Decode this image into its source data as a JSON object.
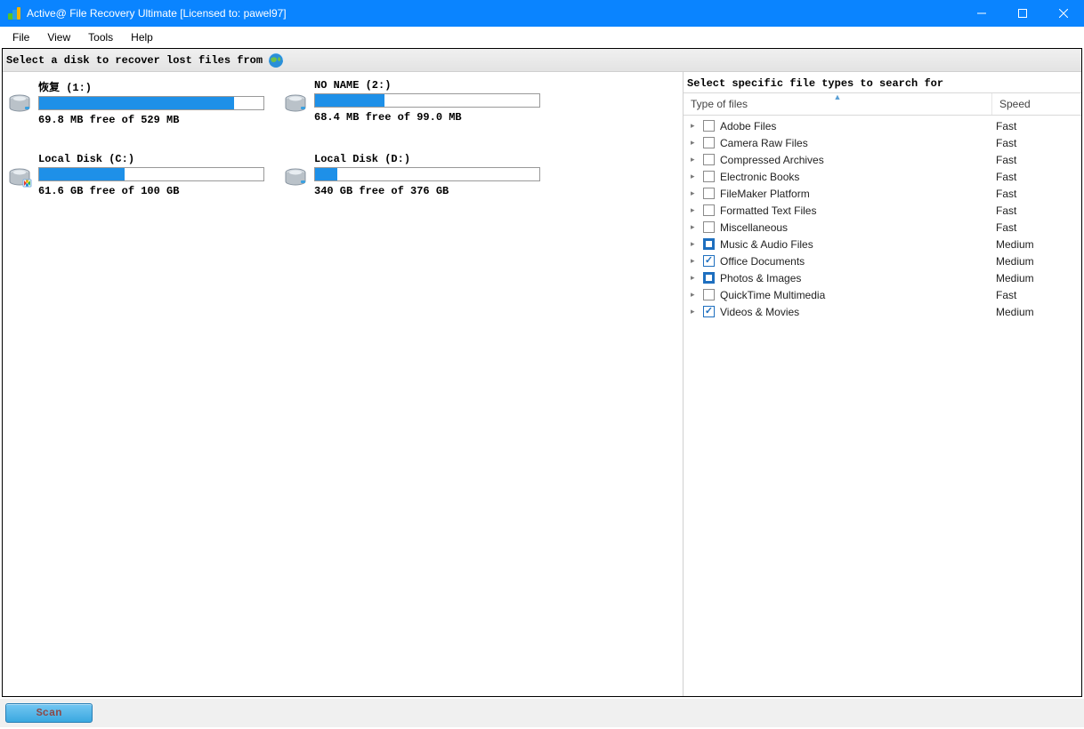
{
  "window": {
    "title": "Active@ File Recovery Ultimate [Licensed to: pawel97]"
  },
  "menu": {
    "file": "File",
    "view": "View",
    "tools": "Tools",
    "help": "Help"
  },
  "headline": "Select a disk to recover lost files from",
  "disks": [
    {
      "name": "恢复 (1:)",
      "free_text": "69.8 MB free of 529 MB",
      "used_pct": 87
    },
    {
      "name": "NO NAME (2:)",
      "free_text": "68.4 MB free of 99.0 MB",
      "used_pct": 31
    },
    {
      "name": "Local Disk (C:)",
      "free_text": "61.6 GB free of 100 GB",
      "used_pct": 38
    },
    {
      "name": "Local Disk (D:)",
      "free_text": "340 GB free of 376 GB",
      "used_pct": 10
    }
  ],
  "right": {
    "header": "Select specific file types to search for",
    "col_type": "Type of files",
    "col_speed": "Speed"
  },
  "filetypes": [
    {
      "label": "Adobe Files",
      "speed": "Fast",
      "state": "unchecked"
    },
    {
      "label": "Camera Raw Files",
      "speed": "Fast",
      "state": "unchecked"
    },
    {
      "label": "Compressed Archives",
      "speed": "Fast",
      "state": "unchecked"
    },
    {
      "label": "Electronic Books",
      "speed": "Fast",
      "state": "unchecked"
    },
    {
      "label": "FileMaker Platform",
      "speed": "Fast",
      "state": "unchecked"
    },
    {
      "label": "Formatted Text Files",
      "speed": "Fast",
      "state": "unchecked"
    },
    {
      "label": "Miscellaneous",
      "speed": "Fast",
      "state": "unchecked"
    },
    {
      "label": "Music & Audio Files",
      "speed": "Medium",
      "state": "mixed"
    },
    {
      "label": "Office Documents",
      "speed": "Medium",
      "state": "checked"
    },
    {
      "label": "Photos & Images",
      "speed": "Medium",
      "state": "mixed"
    },
    {
      "label": "QuickTime Multimedia",
      "speed": "Fast",
      "state": "unchecked"
    },
    {
      "label": "Videos & Movies",
      "speed": "Medium",
      "state": "checked"
    }
  ],
  "scan_label": "Scan"
}
